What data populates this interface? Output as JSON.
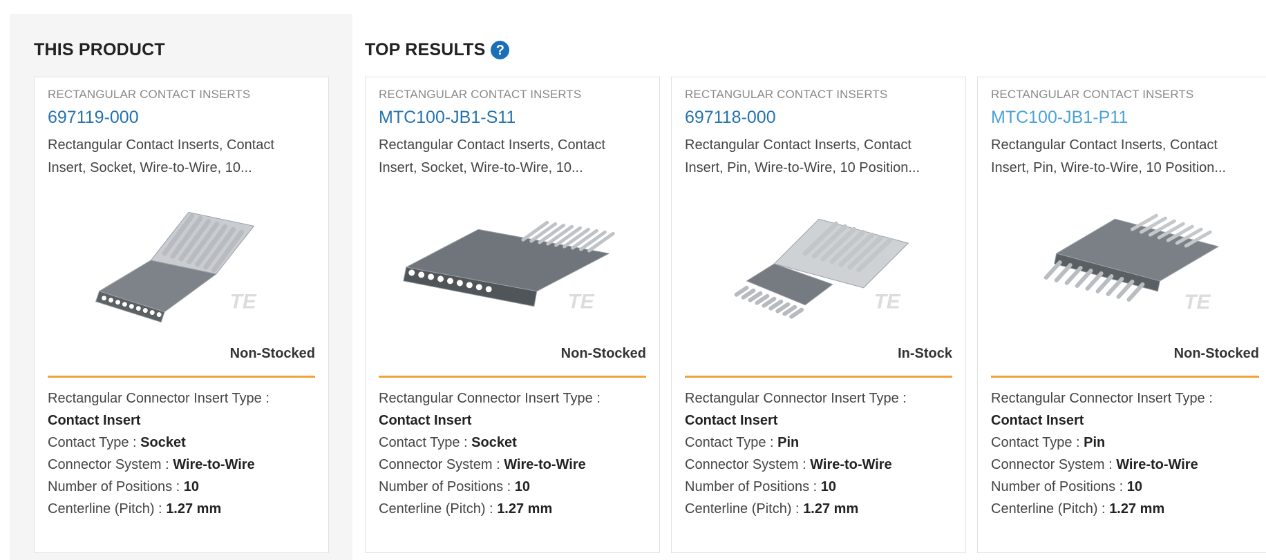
{
  "this_product": {
    "title": "THIS PRODUCT"
  },
  "top_results": {
    "title": "TOP RESULTS",
    "help_icon": "question-circle-icon"
  },
  "colors": {
    "link": "#2473b0",
    "divider": "#f0a33a",
    "help_icon": "#1a6fb7"
  },
  "cards": [
    {
      "category": "RECTANGULAR CONTACT INSERTS",
      "part_number": "697119-000",
      "description": "Rectangular Contact Inserts, Contact Insert, Socket, Wire-to-Wire, 10...",
      "watermark": "TE",
      "stock_status": "Non-Stocked",
      "specs": {
        "insert_type_label": "Rectangular Connector Insert Type :",
        "insert_type_value": "Contact Insert",
        "contact_type_label": "Contact Type :",
        "contact_type_value": "Socket",
        "connector_system_label": "Connector System :",
        "connector_system_value": "Wire-to-Wire",
        "positions_label": "Number of Positions :",
        "positions_value": "10",
        "pitch_label": "Centerline (Pitch) :",
        "pitch_value": "1.27 mm"
      }
    },
    {
      "category": "RECTANGULAR CONTACT INSERTS",
      "part_number": "MTC100-JB1-S11",
      "description": "Rectangular Contact Inserts, Contact Insert, Socket, Wire-to-Wire, 10...",
      "watermark": "TE",
      "stock_status": "Non-Stocked",
      "specs": {
        "insert_type_label": "Rectangular Connector Insert Type :",
        "insert_type_value": "Contact Insert",
        "contact_type_label": "Contact Type :",
        "contact_type_value": "Socket",
        "connector_system_label": "Connector System :",
        "connector_system_value": "Wire-to-Wire",
        "positions_label": "Number of Positions :",
        "positions_value": "10",
        "pitch_label": "Centerline (Pitch) :",
        "pitch_value": "1.27 mm"
      }
    },
    {
      "category": "RECTANGULAR CONTACT INSERTS",
      "part_number": "697118-000",
      "description": "Rectangular Contact Inserts, Contact Insert, Pin, Wire-to-Wire, 10 Position...",
      "watermark": "TE",
      "stock_status": "In-Stock",
      "specs": {
        "insert_type_label": "Rectangular Connector Insert Type :",
        "insert_type_value": "Contact Insert",
        "contact_type_label": "Contact Type :",
        "contact_type_value": "Pin",
        "connector_system_label": "Connector System :",
        "connector_system_value": "Wire-to-Wire",
        "positions_label": "Number of Positions :",
        "positions_value": "10",
        "pitch_label": "Centerline (Pitch) :",
        "pitch_value": "1.27 mm"
      }
    },
    {
      "category": "RECTANGULAR CONTACT INSERTS",
      "part_number": "MTC100-JB1-P11",
      "description": "Rectangular Contact Inserts, Contact Insert, Pin, Wire-to-Wire, 10 Position...",
      "watermark": "TE",
      "stock_status": "Non-Stocked",
      "specs": {
        "insert_type_label": "Rectangular Connector Insert Type :",
        "insert_type_value": "Contact Insert",
        "contact_type_label": "Contact Type :",
        "contact_type_value": "Pin",
        "connector_system_label": "Connector System :",
        "connector_system_value": "Wire-to-Wire",
        "positions_label": "Number of Positions :",
        "positions_value": "10",
        "pitch_label": "Centerline (Pitch) :",
        "pitch_value": "1.27 mm"
      }
    }
  ]
}
